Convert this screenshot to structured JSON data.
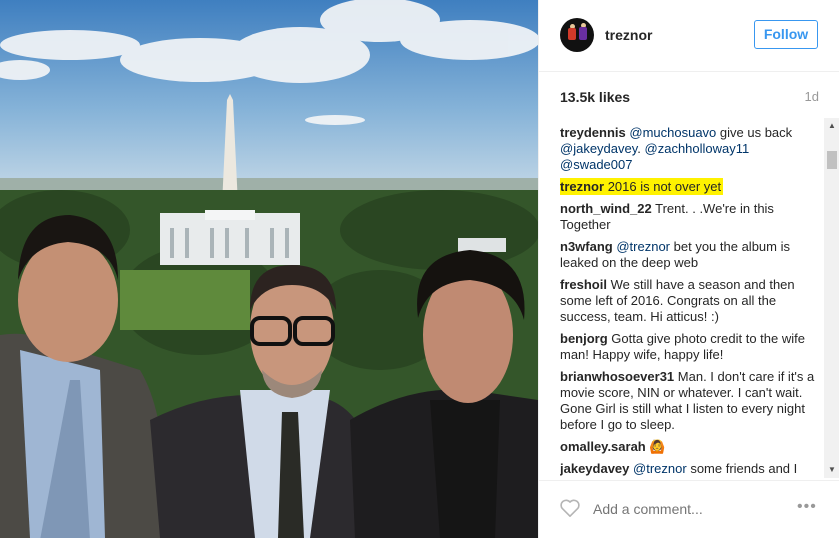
{
  "post": {
    "username": "treznor",
    "follow_label": "Follow",
    "likes": "13.5k likes",
    "age": "1d",
    "add_comment_placeholder": "Add a comment...",
    "more_label": "•••"
  },
  "comments": [
    {
      "user": "treydennis",
      "parts": [
        {
          "t": "mention",
          "v": "@muchosuavo"
        },
        {
          "t": "text",
          "v": " give us back "
        },
        {
          "t": "mention",
          "v": "@jakeydavey"
        },
        {
          "t": "text",
          "v": ". "
        },
        {
          "t": "mention",
          "v": "@zachholloway11"
        },
        {
          "t": "text",
          "v": " "
        },
        {
          "t": "mention",
          "v": "@swade007"
        }
      ]
    },
    {
      "user": "treznor",
      "highlight": true,
      "parts": [
        {
          "t": "text",
          "v": "2016 is not over yet"
        }
      ]
    },
    {
      "user": "north_wind_22",
      "parts": [
        {
          "t": "text",
          "v": "Trent. . .We're in this Together"
        }
      ]
    },
    {
      "user": "n3wfang",
      "parts": [
        {
          "t": "mention",
          "v": "@treznor"
        },
        {
          "t": "text",
          "v": " bet you the album is leaked on the deep web"
        }
      ]
    },
    {
      "user": "freshoil",
      "parts": [
        {
          "t": "text",
          "v": "We still have a season and then some left of 2016. Congrats on all the success, team. Hi atticus! :)"
        }
      ]
    },
    {
      "user": "benjorg",
      "parts": [
        {
          "t": "text",
          "v": "Gotta give photo credit to the wife man! Happy wife, happy life!"
        }
      ]
    },
    {
      "user": "brianwhosoever31",
      "parts": [
        {
          "t": "text",
          "v": "Man. I don't care if it's a movie score, NIN or whatever. I can't wait. Gone Girl is still what I listen to every night before I go to sleep."
        }
      ]
    },
    {
      "user": "omalley.sarah",
      "parts": [
        {
          "t": "text",
          "v": "🙆"
        }
      ]
    },
    {
      "user": "jakeydavey",
      "parts": [
        {
          "t": "mention",
          "v": "@treznor"
        },
        {
          "t": "text",
          "v": " some friends and I"
        }
      ]
    }
  ],
  "icons": {
    "heart": "heart-outline-icon",
    "avatar": "treznor-avatar",
    "scroll_up": "scroll-up-arrow-icon",
    "scroll_down": "scroll-down-arrow-icon"
  },
  "colors": {
    "follow_blue": "#3897f0",
    "highlight": "#fff200",
    "muted": "#999999",
    "mention": "#003569"
  }
}
